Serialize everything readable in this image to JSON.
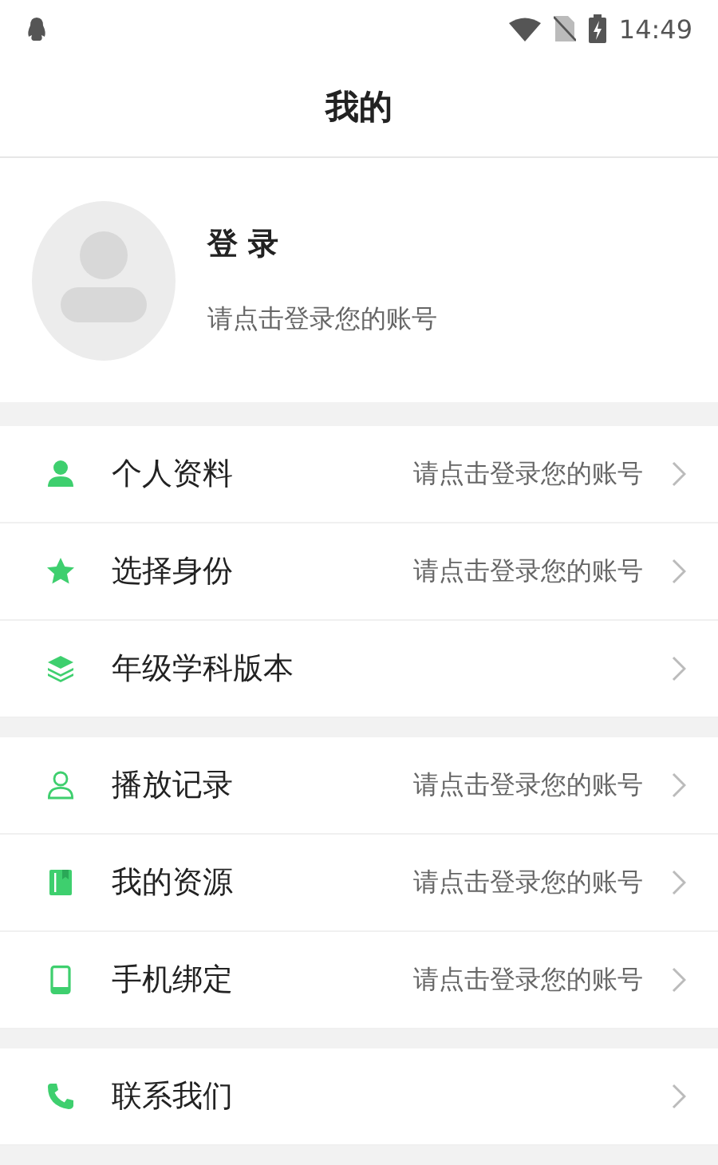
{
  "status_bar": {
    "time": "14:49"
  },
  "header": {
    "title": "我的"
  },
  "profile": {
    "name": "登 录",
    "hint": "请点击登录您的账号"
  },
  "sections": [
    {
      "items": [
        {
          "label": "个人资料",
          "value": "请点击登录您的账号"
        },
        {
          "label": "选择身份",
          "value": "请点击登录您的账号"
        },
        {
          "label": "年级学科版本"
        }
      ]
    },
    {
      "items": [
        {
          "label": "播放记录",
          "value": "请点击登录您的账号"
        },
        {
          "label": "我的资源",
          "value": "请点击登录您的账号"
        },
        {
          "label": "手机绑定",
          "value": "请点击登录您的账号"
        }
      ]
    },
    {
      "items": [
        {
          "label": "联系我们"
        }
      ]
    }
  ]
}
